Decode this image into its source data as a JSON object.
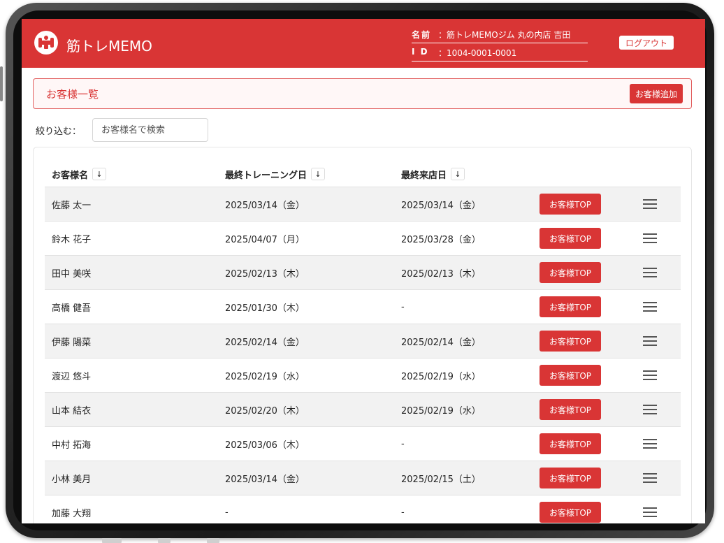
{
  "header": {
    "app_name": "筋トレMEMO",
    "name_label": "名前",
    "name_value": "：筋トレMEMOジム 丸の内店 吉田",
    "id_label": "I D",
    "id_value": "：1004-0001-0001",
    "logout_label": "ログアウト",
    "logo_icon": "dumbbell-icon"
  },
  "list": {
    "title": "お客様一覧",
    "add_label": "お客様追加"
  },
  "filter": {
    "label": "絞り込む：",
    "placeholder": "お客様名で検索"
  },
  "table": {
    "columns": [
      "お客様名",
      "最終トレーニング日",
      "最終来店日"
    ],
    "sort_icon": "↓",
    "top_label": "お客様TOP",
    "rows": [
      {
        "name": "佐藤 太一",
        "last_training": "2025/03/14（金）",
        "last_visit": "2025/03/14（金）"
      },
      {
        "name": "鈴木 花子",
        "last_training": "2025/04/07（月）",
        "last_visit": "2025/03/28（金）"
      },
      {
        "name": "田中 美咲",
        "last_training": "2025/02/13（木）",
        "last_visit": "2025/02/13（木）"
      },
      {
        "name": "高橋 健吾",
        "last_training": "2025/01/30（木）",
        "last_visit": "-"
      },
      {
        "name": "伊藤 陽菜",
        "last_training": "2025/02/14（金）",
        "last_visit": "2025/02/14（金）"
      },
      {
        "name": "渡辺 悠斗",
        "last_training": "2025/02/19（水）",
        "last_visit": "2025/02/19（水）"
      },
      {
        "name": "山本 結衣",
        "last_training": "2025/02/20（木）",
        "last_visit": "2025/02/19（水）"
      },
      {
        "name": "中村 拓海",
        "last_training": "2025/03/06（木）",
        "last_visit": "-"
      },
      {
        "name": "小林 美月",
        "last_training": "2025/03/14（金）",
        "last_visit": "2025/02/15（土）"
      },
      {
        "name": "加藤 大翔",
        "last_training": "-",
        "last_visit": "-"
      }
    ]
  },
  "colors": {
    "accent": "#d93535",
    "row_alt": "#f2f2f2"
  }
}
